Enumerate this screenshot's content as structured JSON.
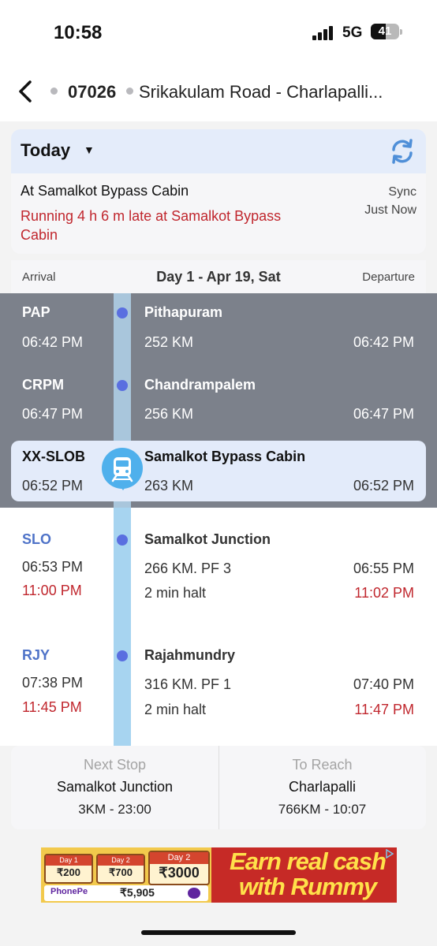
{
  "status_bar": {
    "time": "10:58",
    "network": "5G",
    "battery": "41"
  },
  "header": {
    "back_icon": "chevron-left-icon",
    "train_number": "07026",
    "route": "Srikakulam Road - Charlapalli..."
  },
  "status_card": {
    "day_selector": "Today",
    "refresh_icon": "refresh-icon",
    "location": "At Samalkot Bypass Cabin",
    "delay_text": "Running 4 h  6 m  late at Samalkot Bypass Cabin",
    "sync_label": "Sync",
    "sync_time": "Just Now"
  },
  "day_header": {
    "arrival_label": "Arrival",
    "day_label": "Day 1 - Apr 19, Sat",
    "departure_label": "Departure"
  },
  "stations": [
    {
      "code": "PAP",
      "name": "Pithapuram",
      "arrival": "06:42 PM",
      "km": "252 KM",
      "departure": "06:42 PM",
      "state": "passed"
    },
    {
      "code": "CRPM",
      "name": "Chandrampalem",
      "arrival": "06:47 PM",
      "km": "256 KM",
      "departure": "06:47 PM",
      "state": "passed"
    },
    {
      "code": "XX-SLOB",
      "name": "Samalkot Bypass Cabin",
      "arrival": "06:52 PM",
      "km": "263 KM",
      "departure": "06:52 PM",
      "state": "current"
    },
    {
      "code": "SLO",
      "name": "Samalkot Junction",
      "arrival": "06:53 PM",
      "arrival_expected": "11:00 PM",
      "km": "266 KM. PF 3",
      "halt": "2 min halt",
      "departure": "06:55 PM",
      "departure_expected": "11:02 PM",
      "state": "upcoming"
    },
    {
      "code": "RJY",
      "name": "Rajahmundry",
      "arrival": "07:38 PM",
      "arrival_expected": "11:45 PM",
      "km": "316 KM. PF 1",
      "halt": "2 min halt",
      "departure": "07:40 PM",
      "departure_expected": "11:47 PM",
      "state": "upcoming"
    }
  ],
  "bottom_info": {
    "next_stop_label": "Next Stop",
    "next_stop_name": "Samalkot Junction",
    "next_stop_detail": "3KM - 23:00",
    "to_reach_label": "To Reach",
    "to_reach_name": "Charlapalli",
    "to_reach_detail": "766KM - 10:07"
  },
  "ad": {
    "day1_label": "Day 1",
    "day1_value": "₹200",
    "day2_label": "Day 2",
    "day2_value": "₹700",
    "day2b_label": "Day 2",
    "day2b_value": "₹3000",
    "wallet": "PhonePe",
    "wallet_amount": "₹5,905",
    "headline": "Earn real cash with Rummy"
  },
  "colors": {
    "late": "#c0262d",
    "accent": "#4f73c8",
    "passed_bg": "#7c818b",
    "track": "#a7d4f0"
  }
}
